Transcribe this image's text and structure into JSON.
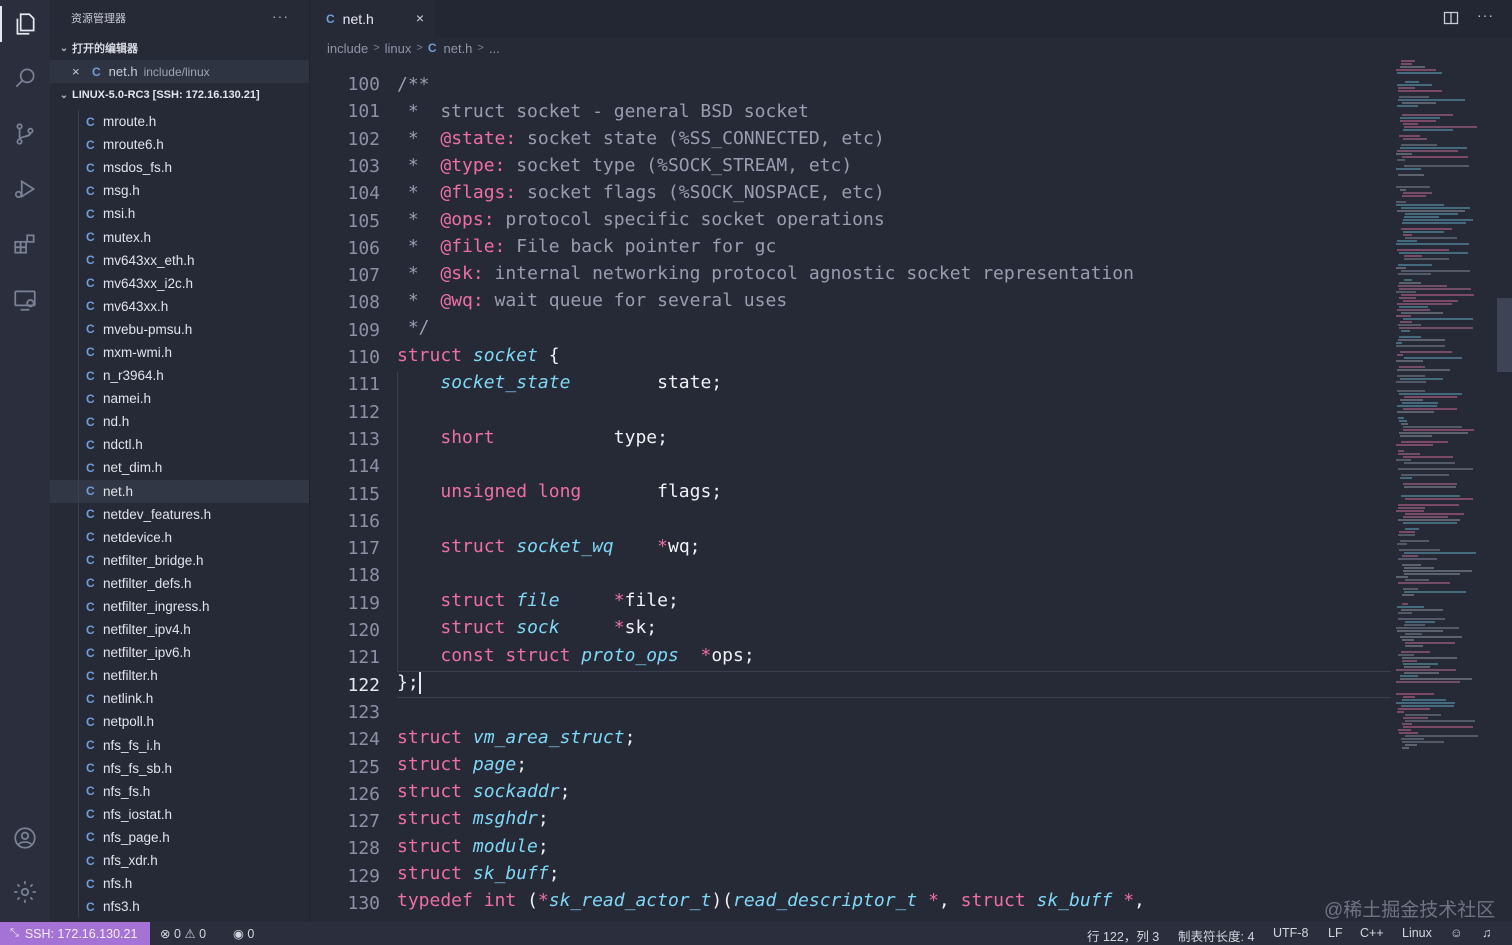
{
  "sidebar": {
    "title": "资源管理器",
    "more": "···",
    "open_editors_label": "打开的编辑器",
    "open_editor": {
      "close": "×",
      "icon": "C",
      "name": "net.h",
      "path": "include/linux"
    },
    "root_label": "LINUX-5.0-RC3 [SSH: 172.16.130.21]",
    "files": [
      "mroute.h",
      "mroute6.h",
      "msdos_fs.h",
      "msg.h",
      "msi.h",
      "mutex.h",
      "mv643xx_eth.h",
      "mv643xx_i2c.h",
      "mv643xx.h",
      "mvebu-pmsu.h",
      "mxm-wmi.h",
      "n_r3964.h",
      "namei.h",
      "nd.h",
      "ndctl.h",
      "net_dim.h",
      "net.h",
      "netdev_features.h",
      "netdevice.h",
      "netfilter_bridge.h",
      "netfilter_defs.h",
      "netfilter_ingress.h",
      "netfilter_ipv4.h",
      "netfilter_ipv6.h",
      "netfilter.h",
      "netlink.h",
      "netpoll.h",
      "nfs_fs_i.h",
      "nfs_fs_sb.h",
      "nfs_fs.h",
      "nfs_iostat.h",
      "nfs_page.h",
      "nfs_xdr.h",
      "nfs.h",
      "nfs3.h"
    ],
    "selected_file": "net.h",
    "file_icon": "C"
  },
  "tab": {
    "icon": "C",
    "label": "net.h",
    "close": "×"
  },
  "breadcrumb": {
    "a": "include",
    "b": "linux",
    "icon": "C",
    "c": "net.h",
    "d": "...",
    "sep": ">"
  },
  "editor": {
    "line_numbers": [
      "100",
      "101",
      "102",
      "103",
      "104",
      "105",
      "106",
      "107",
      "108",
      "109",
      "110",
      "111",
      "112",
      "113",
      "114",
      "115",
      "116",
      "117",
      "118",
      "119",
      "120",
      "121",
      "122",
      "123",
      "124",
      "125",
      "126",
      "127",
      "128",
      "129",
      "130"
    ],
    "current_line": "122"
  },
  "status": {
    "remote": "SSH: 172.16.130.21",
    "errors": "0",
    "warnings": "0",
    "ports": "0",
    "position": "行 122，列 3",
    "tab_size": "制表符长度: 4",
    "encoding": "UTF-8",
    "eol": "LF",
    "language": "C++",
    "config": "Linux"
  },
  "watermark": "@稀土掘金技术社区",
  "colors": {
    "accent_remote": "#a572d6",
    "keyword": "#ee6fa3",
    "type": "#7fd6f5",
    "comment": "#9a9db0",
    "background": "#262a37"
  },
  "icons": [
    "explorer-icon",
    "search-icon",
    "source-control-icon",
    "run-debug-icon",
    "extensions-icon",
    "remote-explorer-icon",
    "account-icon",
    "settings-gear-icon",
    "split-editor-icon",
    "more-actions-icon"
  ]
}
